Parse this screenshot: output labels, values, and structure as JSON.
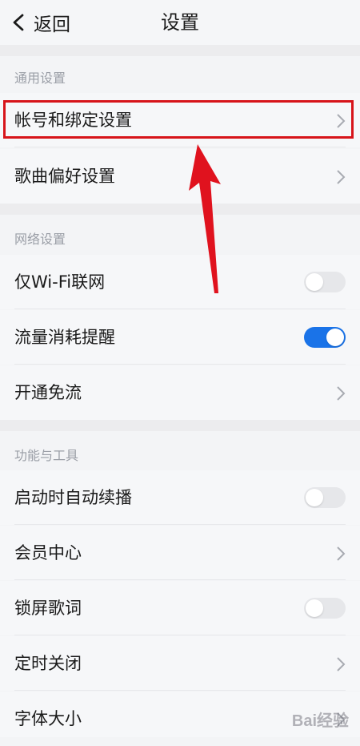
{
  "header": {
    "back_label": "返回",
    "title": "设置"
  },
  "sections": [
    {
      "label": "通用设置",
      "items": [
        {
          "label": "帐号和绑定设置",
          "control": "chevron"
        },
        {
          "label": "歌曲偏好设置",
          "control": "chevron"
        }
      ]
    },
    {
      "label": "网络设置",
      "items": [
        {
          "label": "仅Wi-Fi联网",
          "control": "toggle",
          "state": "off"
        },
        {
          "label": "流量消耗提醒",
          "control": "toggle",
          "state": "on"
        },
        {
          "label": "开通免流",
          "control": "chevron"
        }
      ]
    },
    {
      "label": "功能与工具",
      "items": [
        {
          "label": "启动时自动续播",
          "control": "toggle",
          "state": "off"
        },
        {
          "label": "会员中心",
          "control": "chevron"
        },
        {
          "label": "锁屏歌词",
          "control": "toggle",
          "state": "off"
        },
        {
          "label": "定时关闭",
          "control": "chevron"
        },
        {
          "label": "字体大小",
          "control": "chevron"
        }
      ]
    }
  ],
  "colors": {
    "accent": "#1a73e8",
    "highlight": "#d7141a"
  },
  "watermark": "Bai经验"
}
